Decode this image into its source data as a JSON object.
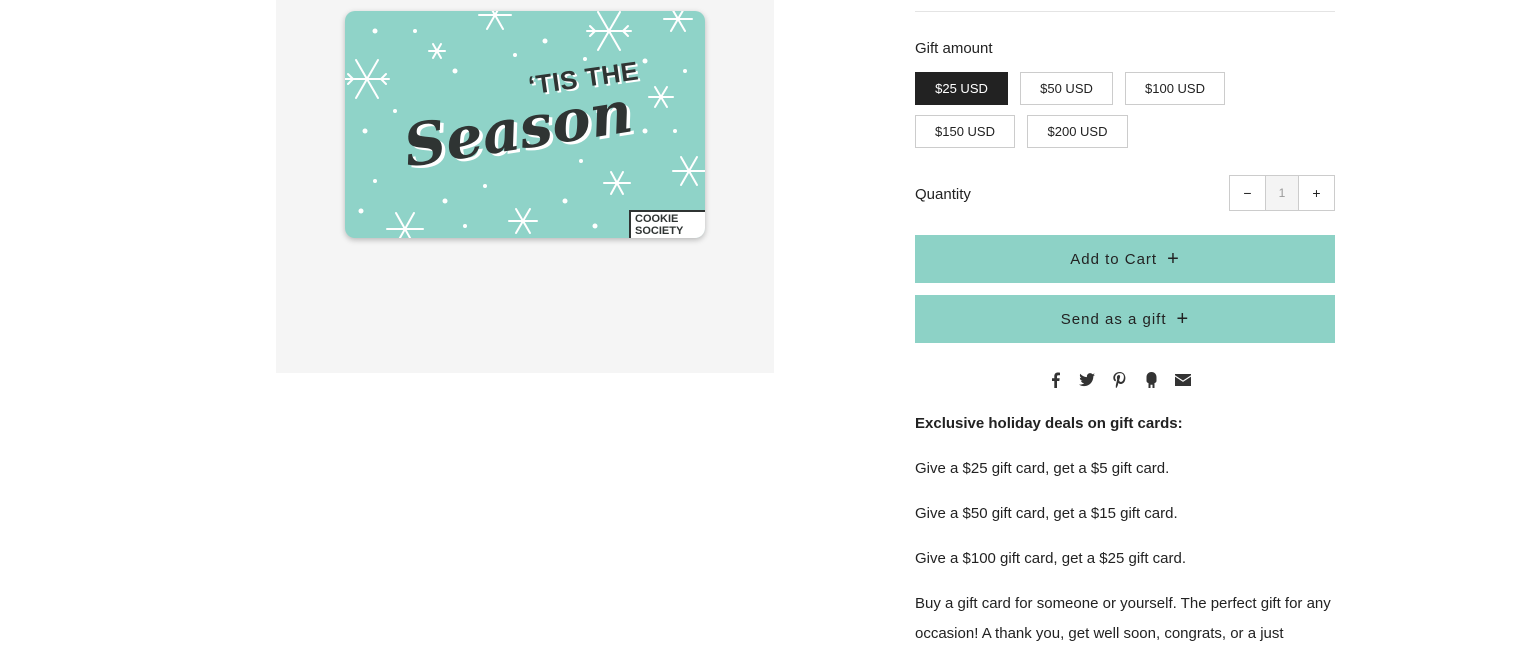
{
  "product_image": {
    "card": {
      "headline": "‘TIS THE",
      "script_word": "Season",
      "brand_logo": "COOKIE\nSOCIETY",
      "background_color": "#8fd3c8"
    }
  },
  "gift_amount": {
    "label": "Gift amount",
    "options": [
      "$25 USD",
      "$50 USD",
      "$100 USD",
      "$150 USD",
      "$200 USD"
    ],
    "selected": "$25 USD"
  },
  "quantity": {
    "label": "Quantity",
    "decrement": "−",
    "increment": "+",
    "value": "1"
  },
  "actions": {
    "add_to_cart": "Add to Cart",
    "send_gift": "Send as a gift",
    "button_color": "#8dd2c6",
    "plus_icon": "+"
  },
  "share_icons": [
    "facebook-icon",
    "twitter-icon",
    "pinterest-icon",
    "fancy-icon",
    "email-icon"
  ],
  "description": {
    "heading": "Exclusive holiday deals on gift cards:",
    "deals": [
      "Give a $25 gift card, get a $5 gift card.",
      "Give a $50 gift card, get a $15 gift card.",
      "Give a $100 gift card, get a $25 gift card."
    ],
    "paragraph": "Buy a gift card for someone or yourself. The perfect gift for any occasion! A thank you, get well soon, congrats, or a just"
  }
}
